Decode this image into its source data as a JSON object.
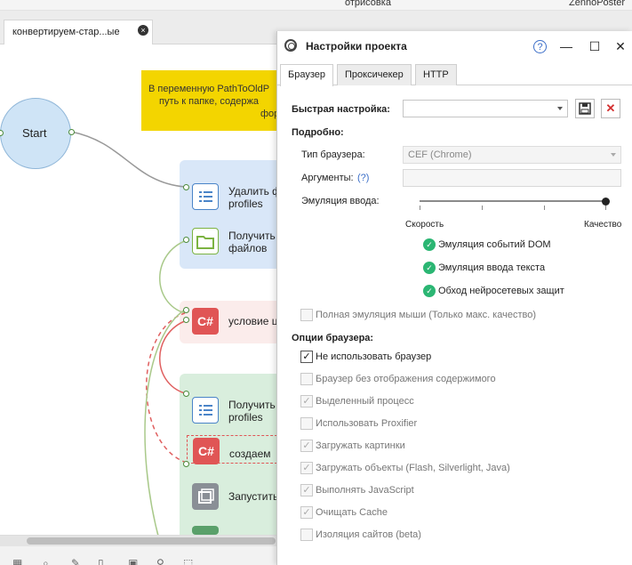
{
  "topbar": {
    "left_text": "отрисовка",
    "right_text": "ZennoPoster"
  },
  "editor_tab": {
    "label": "конвертируем-стар...ые",
    "close_icon": "close-icon"
  },
  "canvas": {
    "note_text_line1": "В переменную PathToOldP",
    "note_text_line2": "путь к папке, содержа",
    "note_text_line3": "форм",
    "start_label": "Start",
    "nodes": [
      {
        "line1": "Удалить ф",
        "line2": "profiles",
        "icon": "list-icon"
      },
      {
        "line1": "Получить",
        "line2": "файлов",
        "icon": "folder-icon"
      },
      {
        "line1": "условие ц",
        "line2": "",
        "icon": "csharp-icon"
      },
      {
        "line1": "Получить",
        "line2": "profiles",
        "icon": "list-icon"
      },
      {
        "line1": "создаем",
        "line2": "",
        "icon": "csharp-icon"
      },
      {
        "line1": "Запустить",
        "line2": "",
        "icon": "copy-icon"
      }
    ],
    "csharp_badge": "C#"
  },
  "dialog": {
    "title": "Настройки проекта",
    "help_label": "?",
    "tabs": [
      "Браузер",
      "Проксичекер",
      "HTTP"
    ],
    "quick_setup_label": "Быстрая настройка:",
    "quick_setup_value": "",
    "details_label": "Подробно:",
    "browser_type_label": "Тип браузера:",
    "browser_type_value": "CEF (Chrome)",
    "args_label": "Аргументы:",
    "args_help": "(?)",
    "input_emulation_label": "Эмуляция ввода:",
    "slider_min_label": "Скорость",
    "slider_max_label": "Качество",
    "slider_value": 1.0,
    "emulation_features": [
      "Эмуляция событий DOM",
      "Эмуляция ввода текста",
      "Обход нейросетевых защит"
    ],
    "full_mouse_label": "Полная эмуляция мыши (Только макс. качество)",
    "browser_options_label": "Опции браузера:",
    "options": [
      {
        "label": "Не использовать браузер",
        "checked": true,
        "enabled": true
      },
      {
        "label": "Браузер без отображения содержимого",
        "checked": false,
        "enabled": false
      },
      {
        "label": "Выделенный процесс",
        "checked": true,
        "enabled": false
      },
      {
        "label": "Использовать Proxifier",
        "checked": false,
        "enabled": false
      },
      {
        "label": "Загружать картинки",
        "checked": true,
        "enabled": false
      },
      {
        "label": "Загружать объекты (Flash, Silverlight, Java)",
        "checked": true,
        "enabled": false
      },
      {
        "label": "Выполнять JavaScript",
        "checked": true,
        "enabled": false
      },
      {
        "label": "Очищать Cache",
        "checked": true,
        "enabled": false
      },
      {
        "label": "Изоляция сайтов (beta)",
        "checked": false,
        "enabled": false
      }
    ]
  }
}
